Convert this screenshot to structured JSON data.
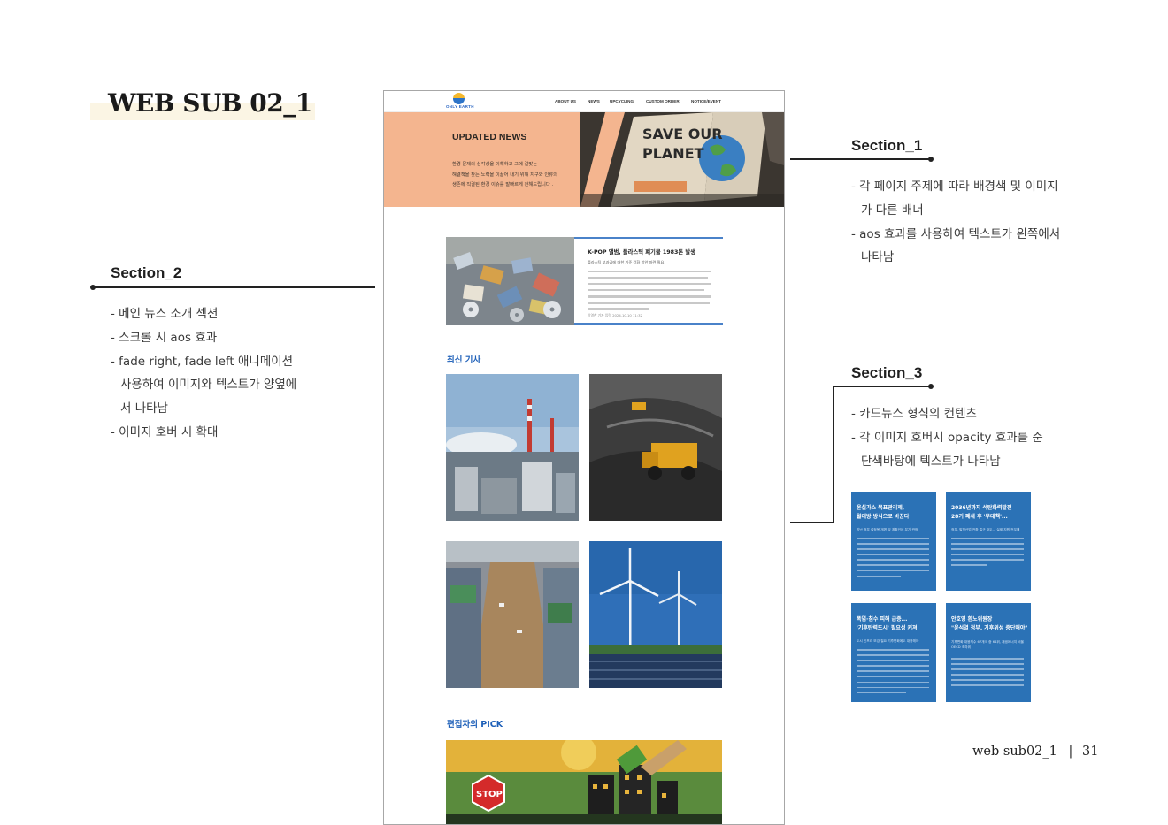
{
  "page_title": "WEB SUB 02_1",
  "annotations": {
    "section1": {
      "title": "Section_1",
      "notes": [
        "- 각 페이지 주제에 따라 배경색 및 이미지",
        "가 다른 배너",
        "- aos 효과를 사용하여 텍스트가 왼쪽에서",
        "나타남"
      ]
    },
    "section2": {
      "title": "Section_2",
      "notes": [
        "- 메인 뉴스 소개 섹션",
        "- 스크롤 시 aos 효과",
        "- fade right, fade left  애니메이션",
        "사용하여 이미지와 텍스트가 양옆에",
        "서 나타남",
        "- 이미지 호버 시 확대"
      ]
    },
    "section3": {
      "title": "Section_3",
      "notes": [
        "- 카드뉴스 형식의 컨텐츠",
        "- 각 이미지 호버시 opacity 효과를 준",
        "단색바탕에 텍스트가 나타남"
      ]
    }
  },
  "mockup": {
    "logo_text": "ONLY EARTH",
    "nav": [
      "ABOUT US",
      "NEWS",
      "UPCYCLING",
      "CUSTOM ORDER",
      "NOTICE/EVENT"
    ],
    "banner": {
      "title": "UPDATED NEWS",
      "desc": [
        "환경 문제의 심각성을 이해하고 그에 걸맞는",
        "해결책을 찾는 노력을 이끌어 내기 위해 지구와 인류의",
        "생존에 직결된 환경 이슈를 발빠르게 전해드립니다 ."
      ],
      "sign_texts": [
        "SAVE OUR",
        "PLANET"
      ]
    },
    "news": {
      "title": "K-POP 앨범, 플라스틱 폐기물 1983톤 발생",
      "subtitle": "플라스틱 부과금에 대한 기준 강화 방안 마련 필요",
      "meta": "이영찬 기자    입력 2024.10.10 11:32"
    },
    "latest_heading": "최신 기사",
    "pick_heading": "편집자의 PICK",
    "pick_sign": "STOP"
  },
  "cards": [
    {
      "title": [
        "온실가스 목표관리제,",
        "월대방 방식으로 바꾼다"
      ],
      "sub": "지난 정부 설정목 개편 및 계획인에 분기 관정"
    },
    {
      "title": [
        "2036년까지 석탄화력발전",
        "28기 폐쇄 후 '무대책'..."
      ],
      "sub": "정부, 발전산업 전환 특구 대두... 실제 지원 전무해"
    },
    {
      "title": [
        "폭염·침수 피해 급증...",
        "'기후탄력도시' 필요성 커져"
      ],
      "sub": "도시 인프라 보강 필요 기후변화에도 대응해야"
    },
    {
      "title": [
        "안호영 환노위원장",
        "\"윤석열 정부, 기후위성 중단해야\""
      ],
      "sub": "기후변화 대응지수 67개국 중 64위, 재생에너지 비율 OECD 최하위"
    }
  ],
  "footer": {
    "label": "web sub02_1",
    "separator": "|",
    "page_number": "31"
  }
}
